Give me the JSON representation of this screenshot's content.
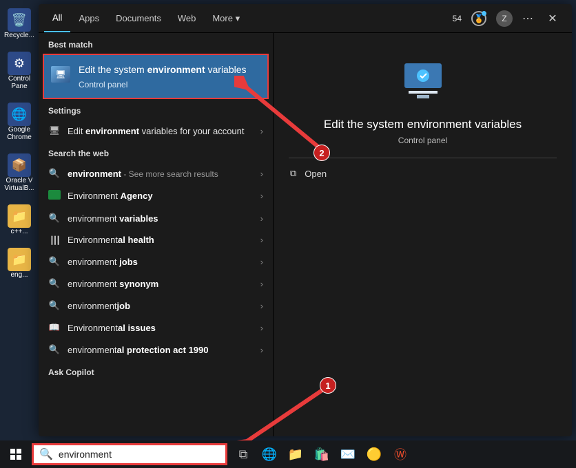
{
  "desktop": {
    "items": [
      {
        "label": "Recycle..."
      },
      {
        "label": "Control Pane"
      },
      {
        "label": "Google Chrome"
      },
      {
        "label": "Oracle V VirtualB..."
      },
      {
        "label": "c++..."
      },
      {
        "label": "eng..."
      }
    ]
  },
  "tabs": {
    "items": [
      "All",
      "Apps",
      "Documents",
      "Web",
      "More"
    ],
    "points": "54",
    "avatar_initial": "Z"
  },
  "sections": {
    "best_match": "Best match",
    "settings": "Settings",
    "search_web": "Search the web",
    "ask_copilot": "Ask Copilot"
  },
  "best": {
    "title_pre": "Edit the system ",
    "title_bold": "environment",
    "title_post": " variables",
    "subtitle": "Control panel"
  },
  "settings_row": {
    "pre": "Edit ",
    "bold": "environment",
    "post": " variables for your account"
  },
  "web": [
    {
      "pre": "",
      "bold": "environment",
      "post": "",
      "extra": " - See more search results"
    },
    {
      "pre": "Environment ",
      "bold": "Agency",
      "post": ""
    },
    {
      "pre": "environment ",
      "bold": "variables",
      "post": ""
    },
    {
      "pre": "Environment",
      "bold": "al health",
      "post": ""
    },
    {
      "pre": "environment ",
      "bold": "jobs",
      "post": ""
    },
    {
      "pre": "environment ",
      "bold": "synonym",
      "post": ""
    },
    {
      "pre": "environment",
      "bold": "job",
      "post": ""
    },
    {
      "pre": "Environment",
      "bold": "al issues",
      "post": ""
    },
    {
      "pre": "environment",
      "bold": "al protection act 1990",
      "post": ""
    }
  ],
  "preview": {
    "title": "Edit the system environment variables",
    "subtitle": "Control panel",
    "open": "Open"
  },
  "search": {
    "value": "environment"
  },
  "annotations": {
    "step1": "1",
    "step2": "2"
  }
}
